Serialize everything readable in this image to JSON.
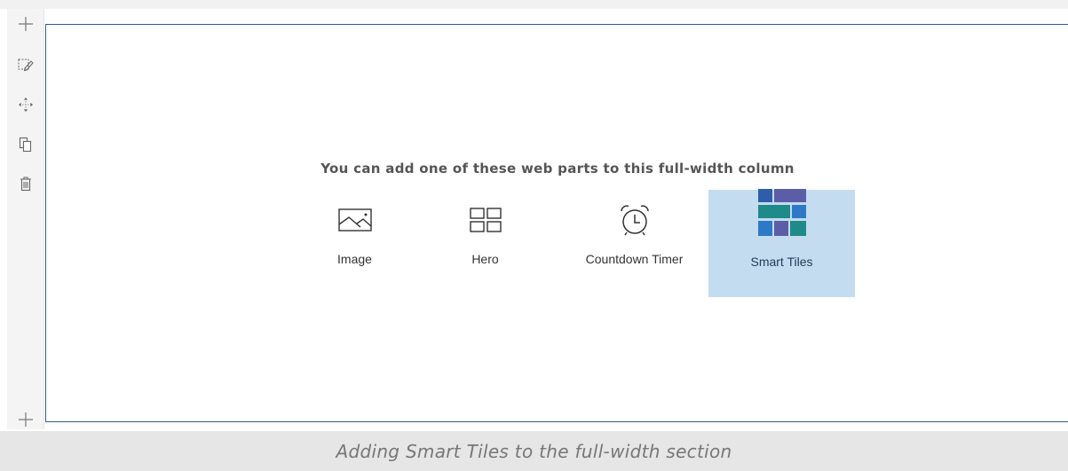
{
  "toolbar": {
    "items": [
      {
        "icon": "plus-icon",
        "label": "Add section"
      },
      {
        "icon": "edit-section-icon",
        "label": "Edit section"
      },
      {
        "icon": "move-icon",
        "label": "Move section"
      },
      {
        "icon": "duplicate-icon",
        "label": "Duplicate section"
      },
      {
        "icon": "trash-icon",
        "label": "Delete section"
      }
    ],
    "bottom_icon": "plus-icon"
  },
  "section": {
    "prompt": "You can add one of these web parts to this full-width column",
    "web_parts": [
      {
        "label": "Image",
        "icon": "image-icon",
        "selected": false
      },
      {
        "label": "Hero",
        "icon": "hero-layout-icon",
        "selected": false
      },
      {
        "label": "Countdown Timer",
        "icon": "alarm-clock-icon",
        "selected": false
      },
      {
        "label": "Smart Tiles",
        "icon": "smart-tiles-icon",
        "selected": true
      }
    ]
  },
  "caption": "Adding Smart Tiles to the full-width section",
  "colors": {
    "section_border": "#2c5f94",
    "selected_bg": "#c4dcef",
    "tile_dark_blue": "#2e5ea8",
    "tile_teal": "#1e8a8a",
    "tile_purple": "#5b5ea6",
    "caption_bar": "#e6e6e6"
  }
}
